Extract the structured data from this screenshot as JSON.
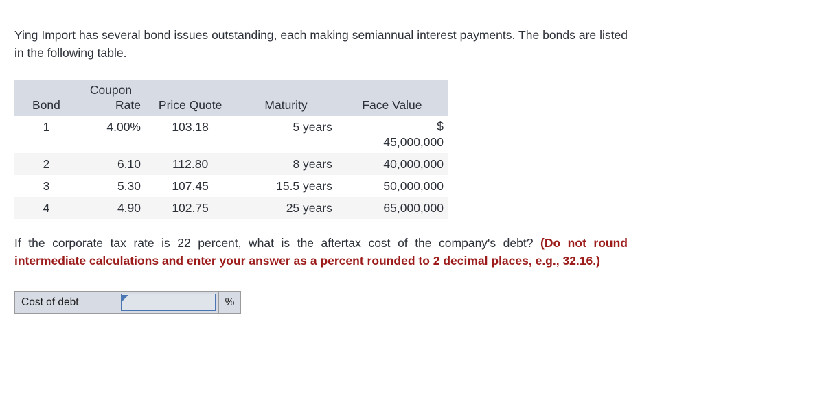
{
  "intro": {
    "text": "Ying Import has several bond issues outstanding, each making semiannual interest payments. The bonds are listed in the following table."
  },
  "table": {
    "headers": {
      "bond": "Bond",
      "coupon_top": "Coupon",
      "coupon_bottom": "Rate",
      "price_quote": "Price Quote",
      "maturity": "Maturity",
      "face_value": "Face Value"
    },
    "rows": [
      {
        "bond": "1",
        "coupon_rate": "4.00%",
        "price_quote": "103.18",
        "maturity": "5 years",
        "face_currency": "$",
        "face_value": "45,000,000"
      },
      {
        "bond": "2",
        "coupon_rate": "6.10",
        "price_quote": "112.80",
        "maturity": "8 years",
        "face_currency": "",
        "face_value": "40,000,000"
      },
      {
        "bond": "3",
        "coupon_rate": "5.30",
        "price_quote": "107.45",
        "maturity": "15.5 years",
        "face_currency": "",
        "face_value": "50,000,000"
      },
      {
        "bond": "4",
        "coupon_rate": "4.90",
        "price_quote": "102.75",
        "maturity": "25 years",
        "face_currency": "",
        "face_value": "65,000,000"
      }
    ]
  },
  "question": {
    "prompt": "If the corporate tax rate is 22 percent, what is the aftertax cost of the company's debt? ",
    "note": "(Do not round intermediate calculations and enter your answer as a percent rounded to 2 decimal places, e.g., 32.16.)"
  },
  "answer": {
    "label": "Cost of debt",
    "value": "",
    "placeholder": "",
    "unit": "%"
  },
  "colors": {
    "header_band": "#d7dbe4",
    "stripe_row": "#f5f5f5",
    "note_red": "#9c1c1c",
    "body_text": "#2c3038",
    "input_border": "#4a77b4",
    "input_fill": "#dfe3ea"
  }
}
